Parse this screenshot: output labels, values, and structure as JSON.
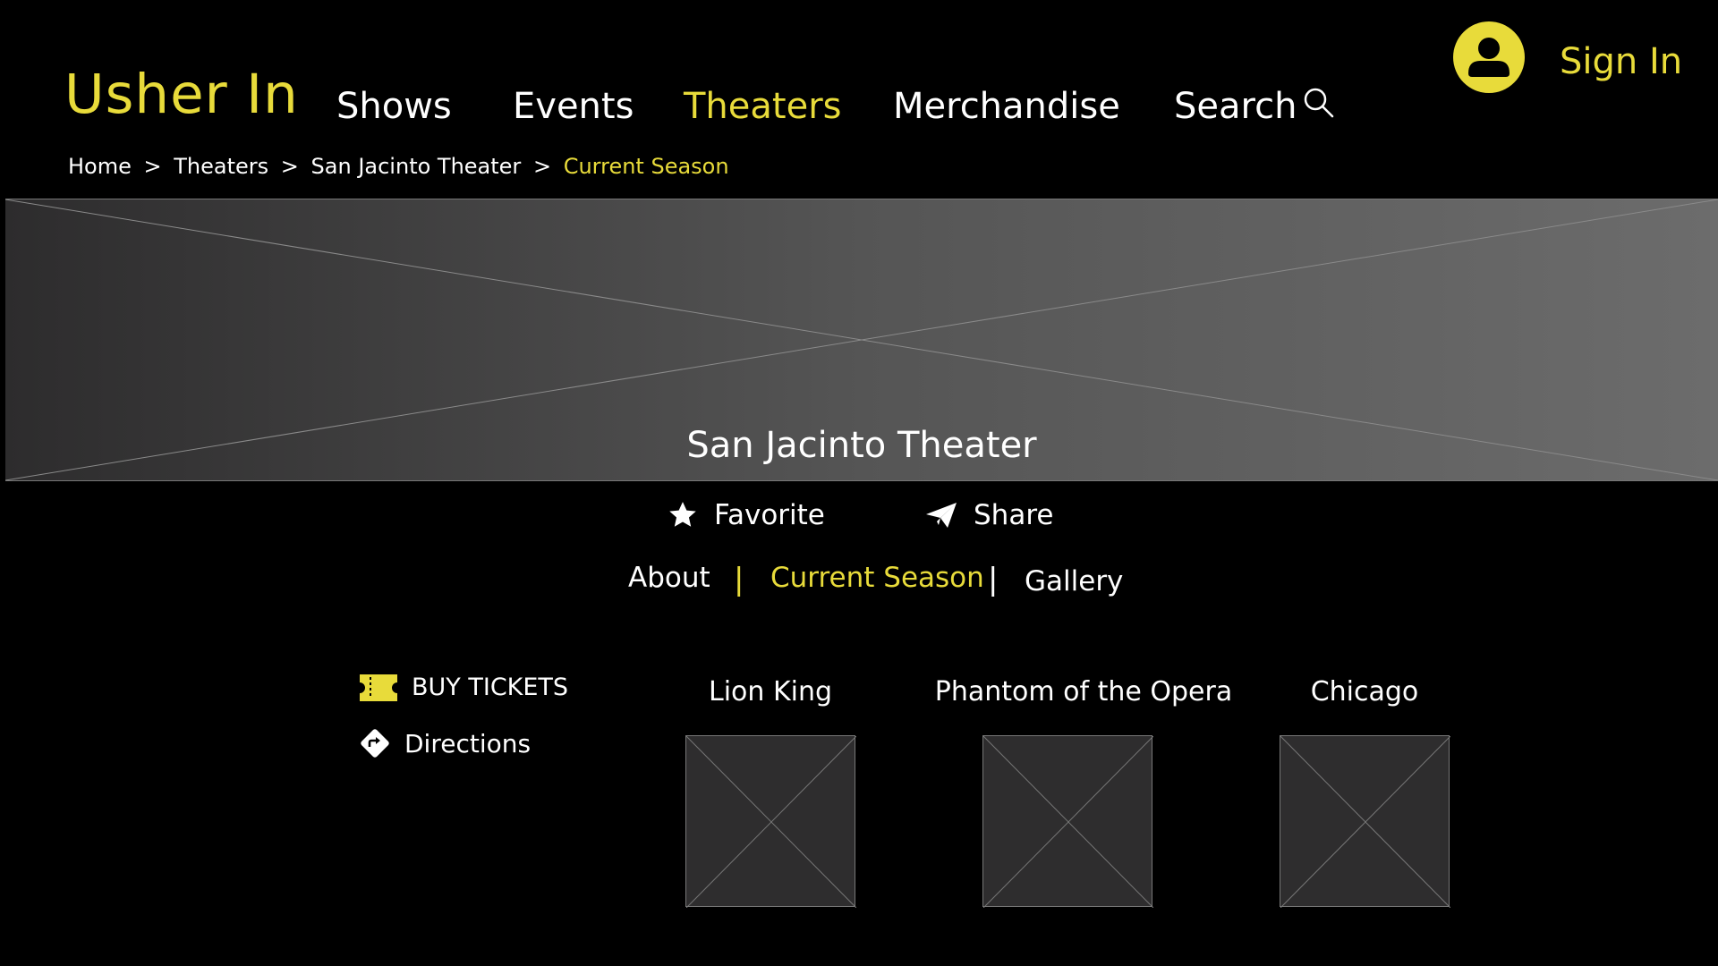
{
  "header": {
    "logo": "Usher In",
    "nav": [
      {
        "label": "Shows",
        "active": false
      },
      {
        "label": "Events",
        "active": false
      },
      {
        "label": "Theaters",
        "active": true
      },
      {
        "label": "Merchandise",
        "active": false
      },
      {
        "label": "Search",
        "active": false
      }
    ],
    "search_icon": "search-icon",
    "sign_in": "Sign In",
    "avatar_icon": "user-avatar-icon"
  },
  "breadcrumb": [
    {
      "label": "Home"
    },
    {
      "label": "Theaters"
    },
    {
      "label": "San Jacinto Theater"
    },
    {
      "label": "Current Season"
    }
  ],
  "breadcrumb_separator": ">",
  "hero": {
    "title": "San Jacinto Theater"
  },
  "actions": {
    "favorite": "Favorite",
    "share": "Share"
  },
  "tabs": [
    {
      "label": "About",
      "active": false
    },
    {
      "label": "Current Season",
      "active": true
    },
    {
      "label": "Gallery",
      "active": false
    }
  ],
  "tab_divider": "|",
  "links": {
    "buy_tickets": "BUY TICKETS",
    "directions": "Directions"
  },
  "shows": [
    {
      "title": "Lion King"
    },
    {
      "title": "Phantom of the Opera"
    },
    {
      "title": "Chicago"
    }
  ],
  "colors": {
    "accent": "#e8db3a",
    "background": "#000000",
    "placeholder": "#2e2d2e"
  }
}
